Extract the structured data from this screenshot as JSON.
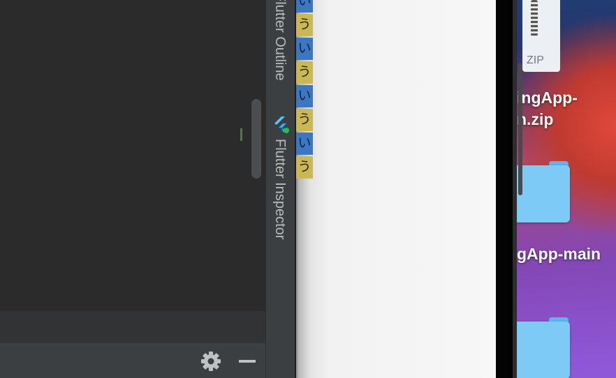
{
  "tool_windows": {
    "outline_label": "Flutter Outline",
    "inspector_label": "Flutter Inspector"
  },
  "bottom_toolbar": {
    "settings_icon": "gear-icon",
    "minimize_icon": "minus-icon"
  },
  "simulator": {
    "rows": [
      {
        "char": "い",
        "kind": "i"
      },
      {
        "char": "う",
        "kind": "u"
      },
      {
        "char": "い",
        "kind": "i"
      },
      {
        "char": "う",
        "kind": "u"
      },
      {
        "char": "い",
        "kind": "i"
      },
      {
        "char": "う",
        "kind": "u"
      },
      {
        "char": "い",
        "kind": "i"
      },
      {
        "char": "う",
        "kind": "u"
      }
    ],
    "colors": {
      "i": "#3c78c2",
      "u": "#c9b853"
    }
  },
  "desktop": {
    "zip_icon_label": "ZIP",
    "zip_name_line1": "ingApp-",
    "zip_name_line2": "n.zip",
    "folder_name": "gApp-main"
  }
}
